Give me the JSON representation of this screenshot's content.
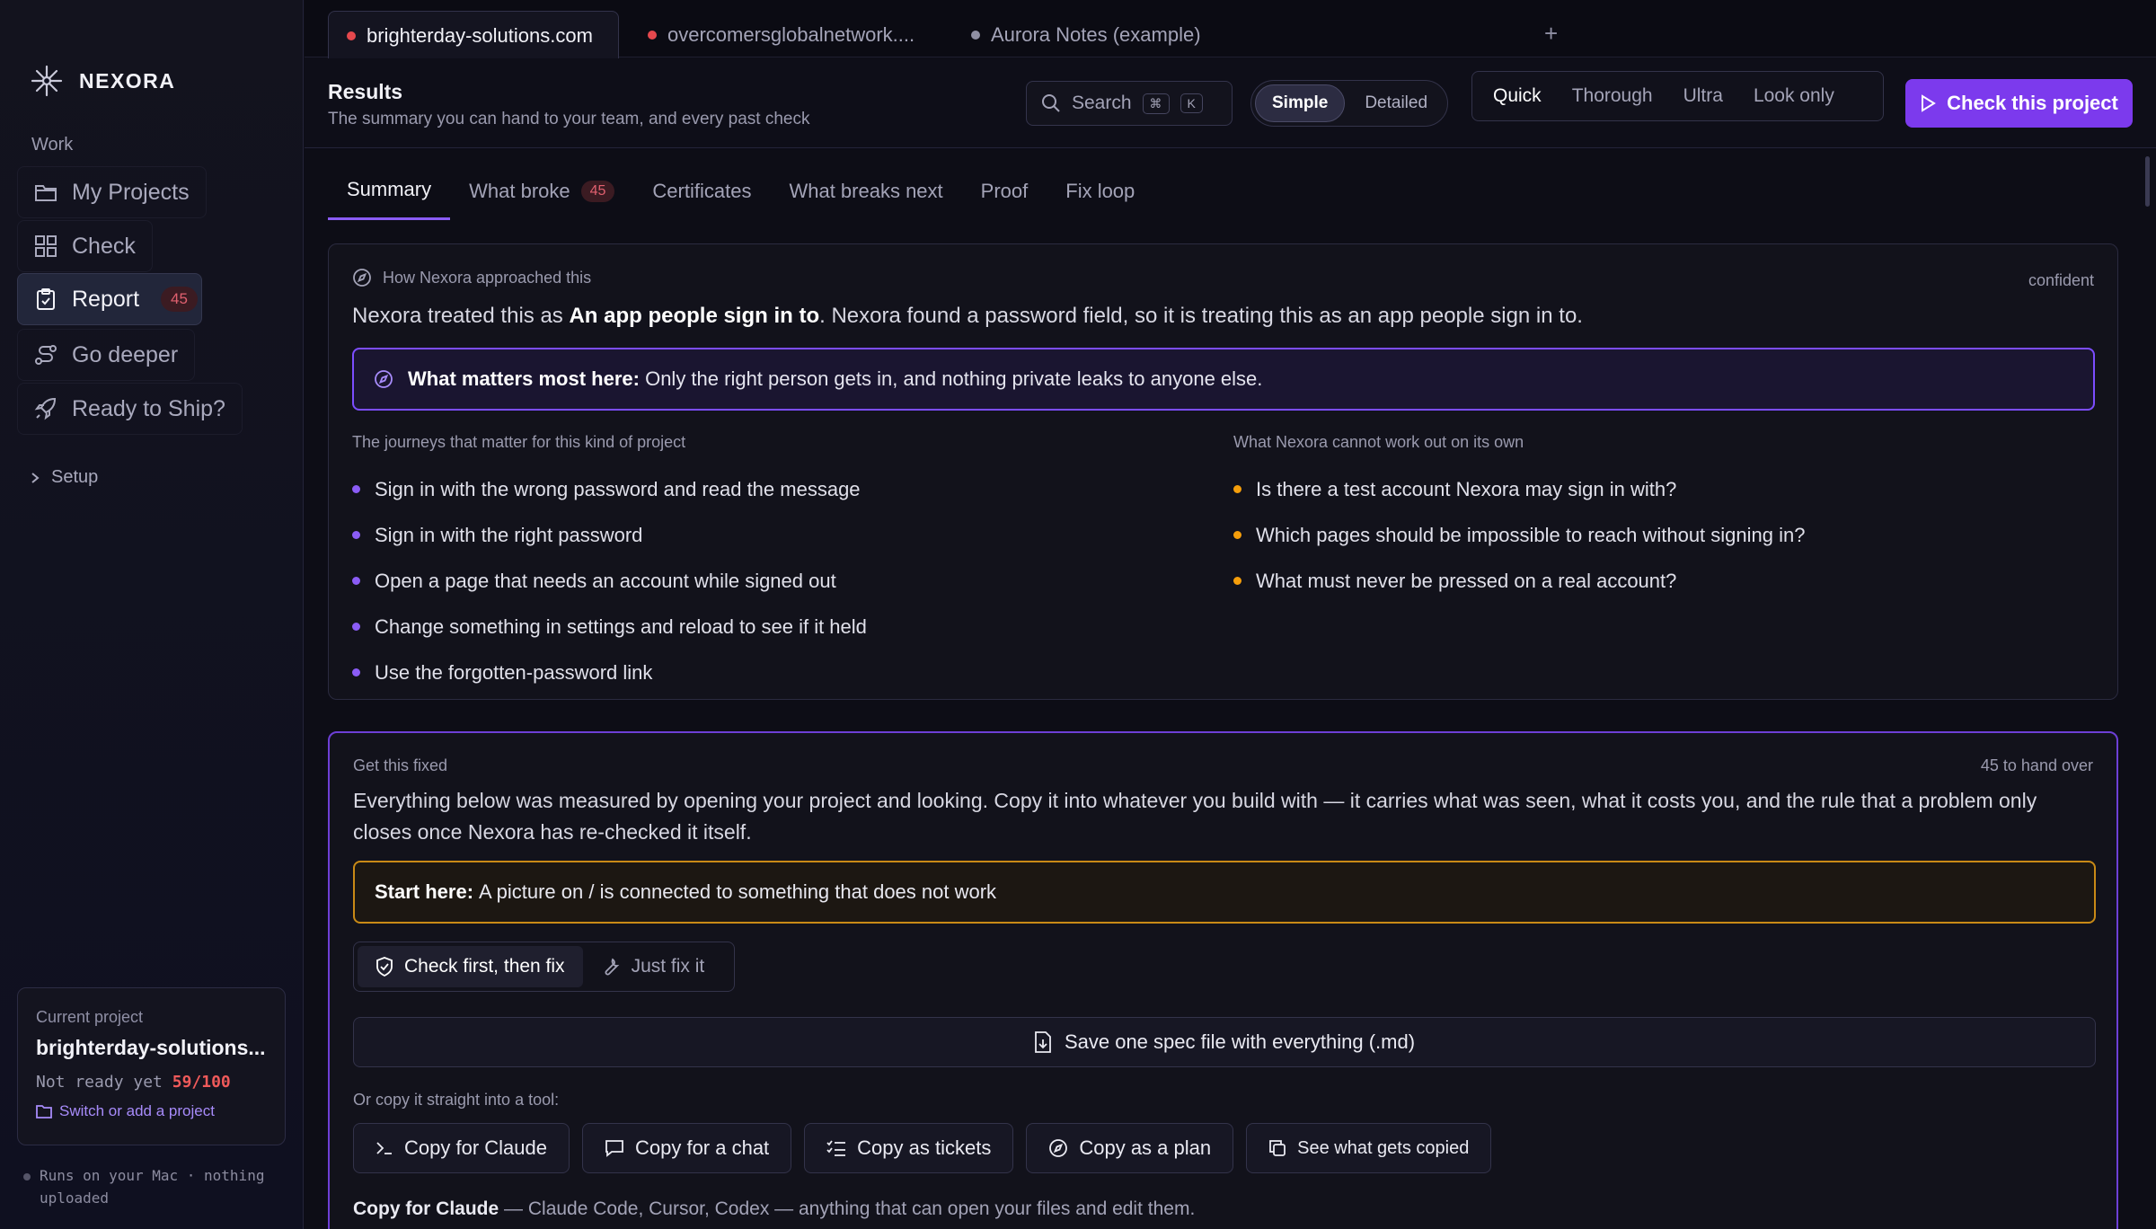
{
  "brand": {
    "name": "NEXORA"
  },
  "sidebar": {
    "section": "Work",
    "items": [
      {
        "label": "My Projects",
        "icon": "folder-icon"
      },
      {
        "label": "Check",
        "icon": "grid-icon"
      },
      {
        "label": "Report",
        "icon": "clipboard-icon",
        "badge": "45",
        "active": true
      },
      {
        "label": "Go deeper",
        "icon": "route-icon"
      },
      {
        "label": "Ready to Ship?",
        "icon": "rocket-icon"
      }
    ],
    "setup": "Setup",
    "current_project": {
      "label": "Current project",
      "name": "brighterday-solutions....",
      "status": "Not ready yet",
      "score": "59/100",
      "switch": "Switch or add a project"
    },
    "footer": "Runs on your Mac · nothing uploaded"
  },
  "tabs": [
    {
      "label": "brighterday-solutions.com",
      "dot": "#e5484d",
      "active": true
    },
    {
      "label": "overcomersglobalnetwork....",
      "dot": "#e5484d"
    },
    {
      "label": "Aurora Notes (example)",
      "dot": "#8f8fa3"
    }
  ],
  "header": {
    "title": "Results",
    "subtitle": "The summary you can hand to your team, and every past check",
    "search": "Search",
    "kbd1": "⌘",
    "kbd2": "K",
    "view": [
      "Simple",
      "Detailed"
    ],
    "depth": [
      "Quick",
      "Thorough",
      "Ultra",
      "Look only"
    ],
    "cta": "Check this project"
  },
  "subtabs": [
    {
      "label": "Summary",
      "active": true
    },
    {
      "label": "What broke",
      "badge": "45"
    },
    {
      "label": "Certificates"
    },
    {
      "label": "What breaks next"
    },
    {
      "label": "Proof"
    },
    {
      "label": "Fix loop"
    }
  ],
  "approach": {
    "label": "How Nexora approached this",
    "confidence": "confident",
    "text_a": "Nexora treated this as ",
    "text_b": "An app people sign in to",
    "text_c": ". Nexora found a password field, so it is treating this as an app people sign in to.",
    "matters_label": "What matters most here:",
    "matters_text": "Only the right person gets in, and nothing private leaks to anyone else.",
    "journeys_title": "The journeys that matter for this kind of project",
    "journeys": [
      "Sign in with the wrong password and read the message",
      "Sign in with the right password",
      "Open a page that needs an account while signed out",
      "Change something in settings and reload to see if it held",
      "Use the forgotten-password link"
    ],
    "questions_title": "What Nexora cannot work out on its own",
    "questions": [
      "Is there a test account Nexora may sign in with?",
      "Which pages should be impossible to reach without signing in?",
      "What must never be pressed on a real account?"
    ]
  },
  "fix": {
    "label": "Get this fixed",
    "handover": "45 to hand over",
    "text": "Everything below was measured by opening your project and looking. Copy it into whatever you build with — it carries what was seen, what it costs you, and the rule that a problem only closes once Nexora has re-checked it itself.",
    "start_label": "Start here:",
    "start_text": "A picture on / is connected to something that does not work",
    "mode": [
      "Check first, then fix",
      "Just fix it"
    ],
    "save": "Save one spec file with everything (.md)",
    "copy_label": "Or copy it straight into a tool:",
    "copy_buttons": [
      "Copy for Claude",
      "Copy for a chat",
      "Copy as tickets",
      "Copy as a plan",
      "See what gets copied"
    ],
    "note_label": "Copy for Claude",
    "note_text": " — Claude Code, Cursor, Codex — anything that can open your files and edit them."
  },
  "colors": {
    "accent": "#7c3aed",
    "warning": "#c98a16",
    "danger": "#e5484d",
    "bullet_purple": "#8b5cf6",
    "bullet_orange": "#f59e0b"
  }
}
